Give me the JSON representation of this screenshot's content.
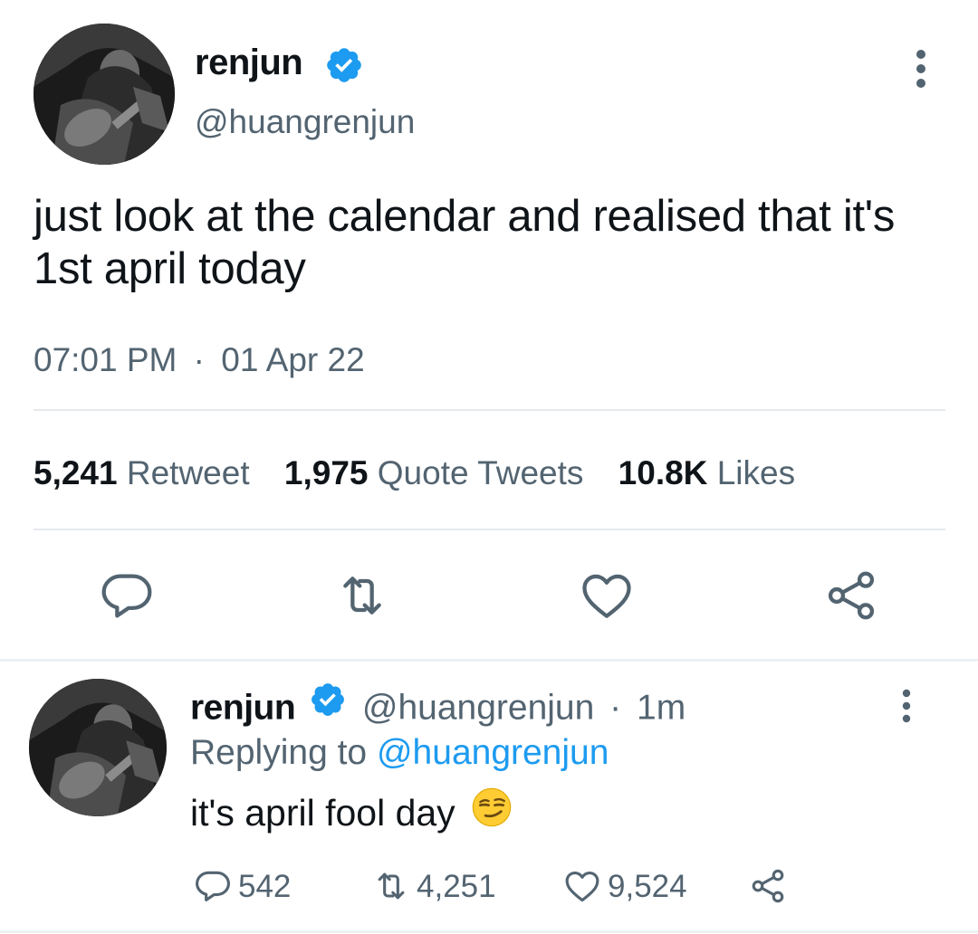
{
  "main_tweet": {
    "display_name": "renjun",
    "handle": "@huangrenjun",
    "text": "just look at the calendar and realised that it's 1st april today",
    "time": "07:01 PM",
    "separator": "·",
    "date": "01 Apr 22",
    "stats": [
      {
        "count": "5,241",
        "label": "Retweet"
      },
      {
        "count": "1,975",
        "label": "Quote Tweets"
      },
      {
        "count": "10.8K",
        "label": "Likes"
      }
    ],
    "actions": [
      "reply-icon",
      "retweet-icon",
      "like-icon",
      "share-icon"
    ]
  },
  "reply_tweet": {
    "display_name": "renjun",
    "handle": "@huangrenjun",
    "separator": "·",
    "age": "1m",
    "replying_label": "Replying to",
    "replying_to": "@huangrenjun",
    "text": "it's april fool day",
    "emoji": "smirking-face-emoji",
    "reply_count": "542",
    "retweet_count": "4,251",
    "like_count": "9,524"
  },
  "colors": {
    "verified": "#1d9bf0",
    "link": "#1d9bf0",
    "secondary_text": "#536471",
    "icon": "#536471",
    "divider": "#e6e9ec"
  }
}
